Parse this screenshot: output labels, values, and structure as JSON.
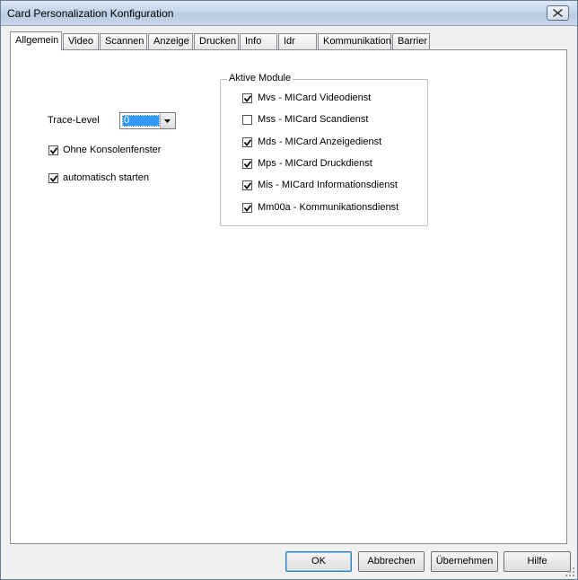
{
  "window": {
    "title": "Card Personalization Konfiguration",
    "close_icon": "close-icon"
  },
  "tabs": [
    {
      "label": "Allgemein",
      "active": true
    },
    {
      "label": "Video"
    },
    {
      "label": "Scannen"
    },
    {
      "label": "Anzeige"
    },
    {
      "label": "Drucken"
    },
    {
      "label": "Info"
    },
    {
      "label": "Idr"
    },
    {
      "label": "Kommunikation"
    },
    {
      "label": "Barrier"
    }
  ],
  "general": {
    "trace_level_label": "Trace-Level",
    "trace_level_value": "0",
    "options": [
      {
        "label": "Ohne Konsolenfenster",
        "checked": true
      },
      {
        "label": "automatisch starten",
        "checked": true
      }
    ]
  },
  "modules": {
    "title": "Aktive Module",
    "items": [
      {
        "label": "Mvs - MICard Videodienst",
        "checked": true
      },
      {
        "label": "Mss - MICard Scandienst",
        "checked": false
      },
      {
        "label": "Mds - MICard Anzeigedienst",
        "checked": true
      },
      {
        "label": "Mps - MICard Druckdienst",
        "checked": true
      },
      {
        "label": "Mis - MICard Informationsdienst",
        "checked": true
      },
      {
        "label": "Mm00a - Kommunikationsdienst",
        "checked": true
      }
    ]
  },
  "buttons": {
    "ok": "OK",
    "cancel": "Abbrechen",
    "apply": "Übernehmen",
    "help": "Hilfe"
  },
  "colors": {
    "selection": "#3399ff",
    "panel": "#ffffff",
    "chrome": "#f0f0f0"
  }
}
